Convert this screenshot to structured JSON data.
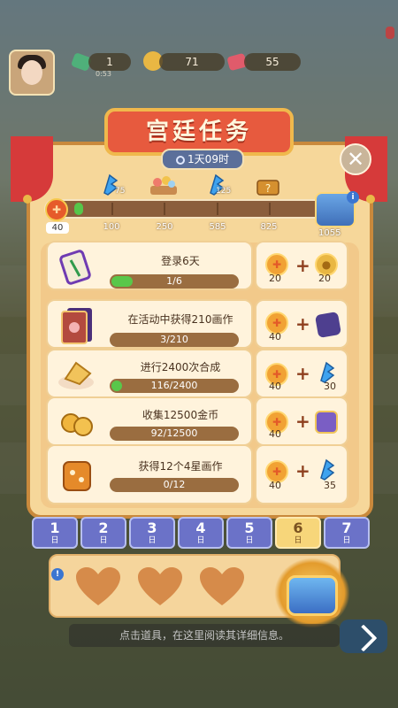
{
  "hud": {
    "gem_green_count": "1",
    "gem_green_sub": "0:53",
    "coins": "71",
    "gem_red_count": "55"
  },
  "modal": {
    "title": "宫廷任务",
    "timer": "1天09时"
  },
  "progress": {
    "start_value": "40",
    "milestones": [
      {
        "label": "100",
        "reward_count": "75",
        "icon": "blue-feather-icon"
      },
      {
        "label": "250",
        "reward_count": "",
        "icon": "gift-tray-icon"
      },
      {
        "label": "585",
        "reward_count": "125",
        "icon": "blue-feather-icon"
      },
      {
        "label": "825",
        "reward_count": "",
        "icon": "mystery-chest-icon"
      }
    ],
    "final_value": "1055",
    "fill_fraction": 0.02
  },
  "tasks": [
    {
      "title": "登录6天",
      "progress": "1/6",
      "fraction": 0.17,
      "reward_a": "20",
      "reward_b": "20",
      "icon": "bamboo-tile-icon",
      "reward_b_icon": "gold-coin-icon"
    },
    {
      "title": "在活动中获得210画作",
      "progress": "3/210",
      "fraction": 0.0,
      "reward_a": "40",
      "reward_b": "",
      "icon": "painting-book-icon",
      "reward_b_icon": "dice-box-icon"
    },
    {
      "title": "进行2400次合成",
      "progress": "116/2400",
      "fraction": 0.05,
      "reward_a": "40",
      "reward_b": "30",
      "icon": "merge-hand-icon",
      "reward_b_icon": "blue-feather-icon"
    },
    {
      "title": "收集12500金币",
      "progress": "92/12500",
      "fraction": 0.0,
      "reward_a": "40",
      "reward_b": "",
      "icon": "coin-pile-icon",
      "reward_b_icon": "purple-chest-icon"
    },
    {
      "title": "获得12个4星画作",
      "progress": "0/12",
      "fraction": 0.0,
      "reward_a": "40",
      "reward_b": "35",
      "icon": "orange-bag-icon",
      "reward_b_icon": "blue-feather-icon"
    }
  ],
  "days": [
    {
      "n": "1",
      "u": "日"
    },
    {
      "n": "2",
      "u": "日"
    },
    {
      "n": "3",
      "u": "日"
    },
    {
      "n": "4",
      "u": "日"
    },
    {
      "n": "5",
      "u": "日"
    },
    {
      "n": "6",
      "u": "日"
    },
    {
      "n": "7",
      "u": "日"
    }
  ],
  "active_day": 6,
  "bottom": {
    "hint": "点击道具，在这里阅读其详细信息。"
  },
  "colors": {
    "accent_red": "#e75a3e",
    "progress_green": "#59c74a",
    "tab_blue": "#6b72c8",
    "tab_active": "#f7d67a"
  }
}
